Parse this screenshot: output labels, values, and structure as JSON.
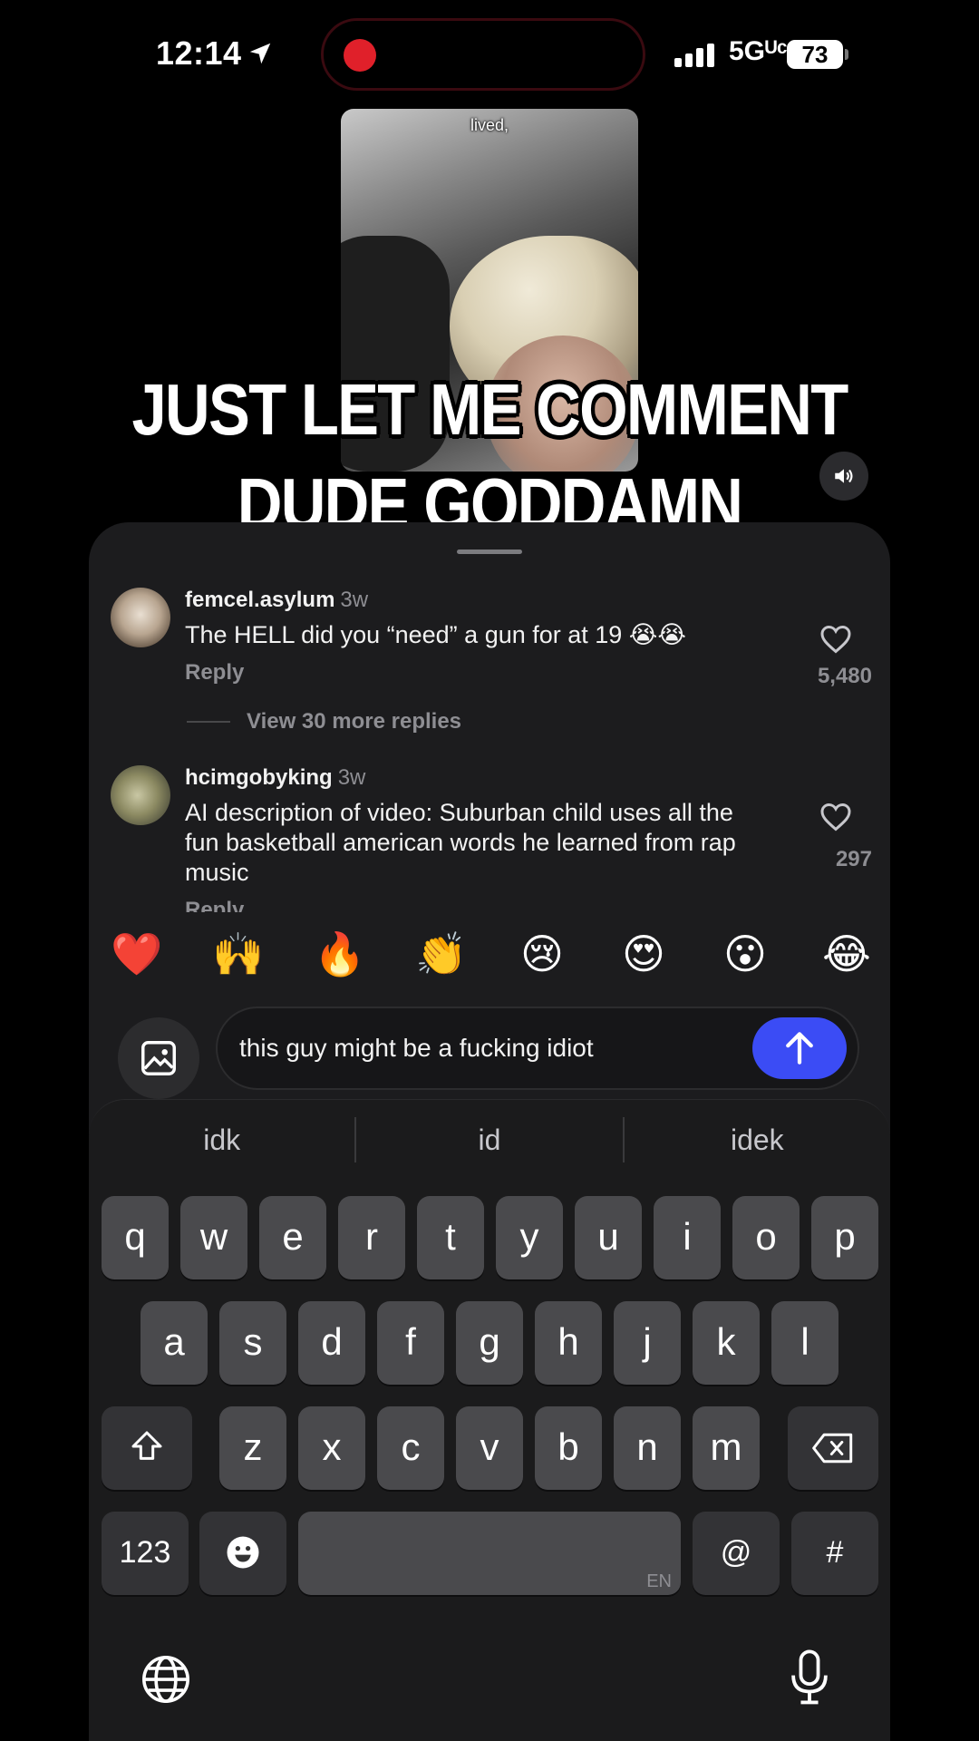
{
  "status_bar": {
    "time": "12:14",
    "network": "5Gᵁᶜ",
    "battery": "73"
  },
  "video": {
    "caption": "lived,",
    "overlay_line1": "JUST LET ME COMMENT",
    "overlay_line2": "DUDE GODDAMN"
  },
  "comments": [
    {
      "username": "femcel.asylum",
      "time": "3w",
      "text": "The HELL did you “need” a gun for at 19 😭😭",
      "reply_label": "Reply",
      "likes": "5,480",
      "view_replies": "View 30 more replies"
    },
    {
      "username": "hcimgobyking",
      "time": "3w",
      "text": "AI description of video: Suburban child uses all the fun basketball american words he learned from rap music",
      "reply_label": "Reply",
      "likes": "297"
    }
  ],
  "emoji_bar": [
    "❤️",
    "🙌",
    "🔥",
    "👏",
    "😢",
    "😍",
    "😮",
    "😂"
  ],
  "composer": {
    "text": "this guy might be a fucking idiot"
  },
  "keyboard": {
    "suggestions": [
      "idk",
      "id",
      "idek"
    ],
    "row1": [
      "q",
      "w",
      "e",
      "r",
      "t",
      "y",
      "u",
      "i",
      "o",
      "p"
    ],
    "row2": [
      "a",
      "s",
      "d",
      "f",
      "g",
      "h",
      "j",
      "k",
      "l"
    ],
    "row3": [
      "z",
      "x",
      "c",
      "v",
      "b",
      "n",
      "m"
    ],
    "numbers_label": "123",
    "space_lang": "EN",
    "at_label": "@",
    "hash_label": "#"
  },
  "colors": {
    "send_button": "#3b4cf5",
    "panel_bg": "#1c1c1e",
    "recording_dot": "#e0202a"
  }
}
